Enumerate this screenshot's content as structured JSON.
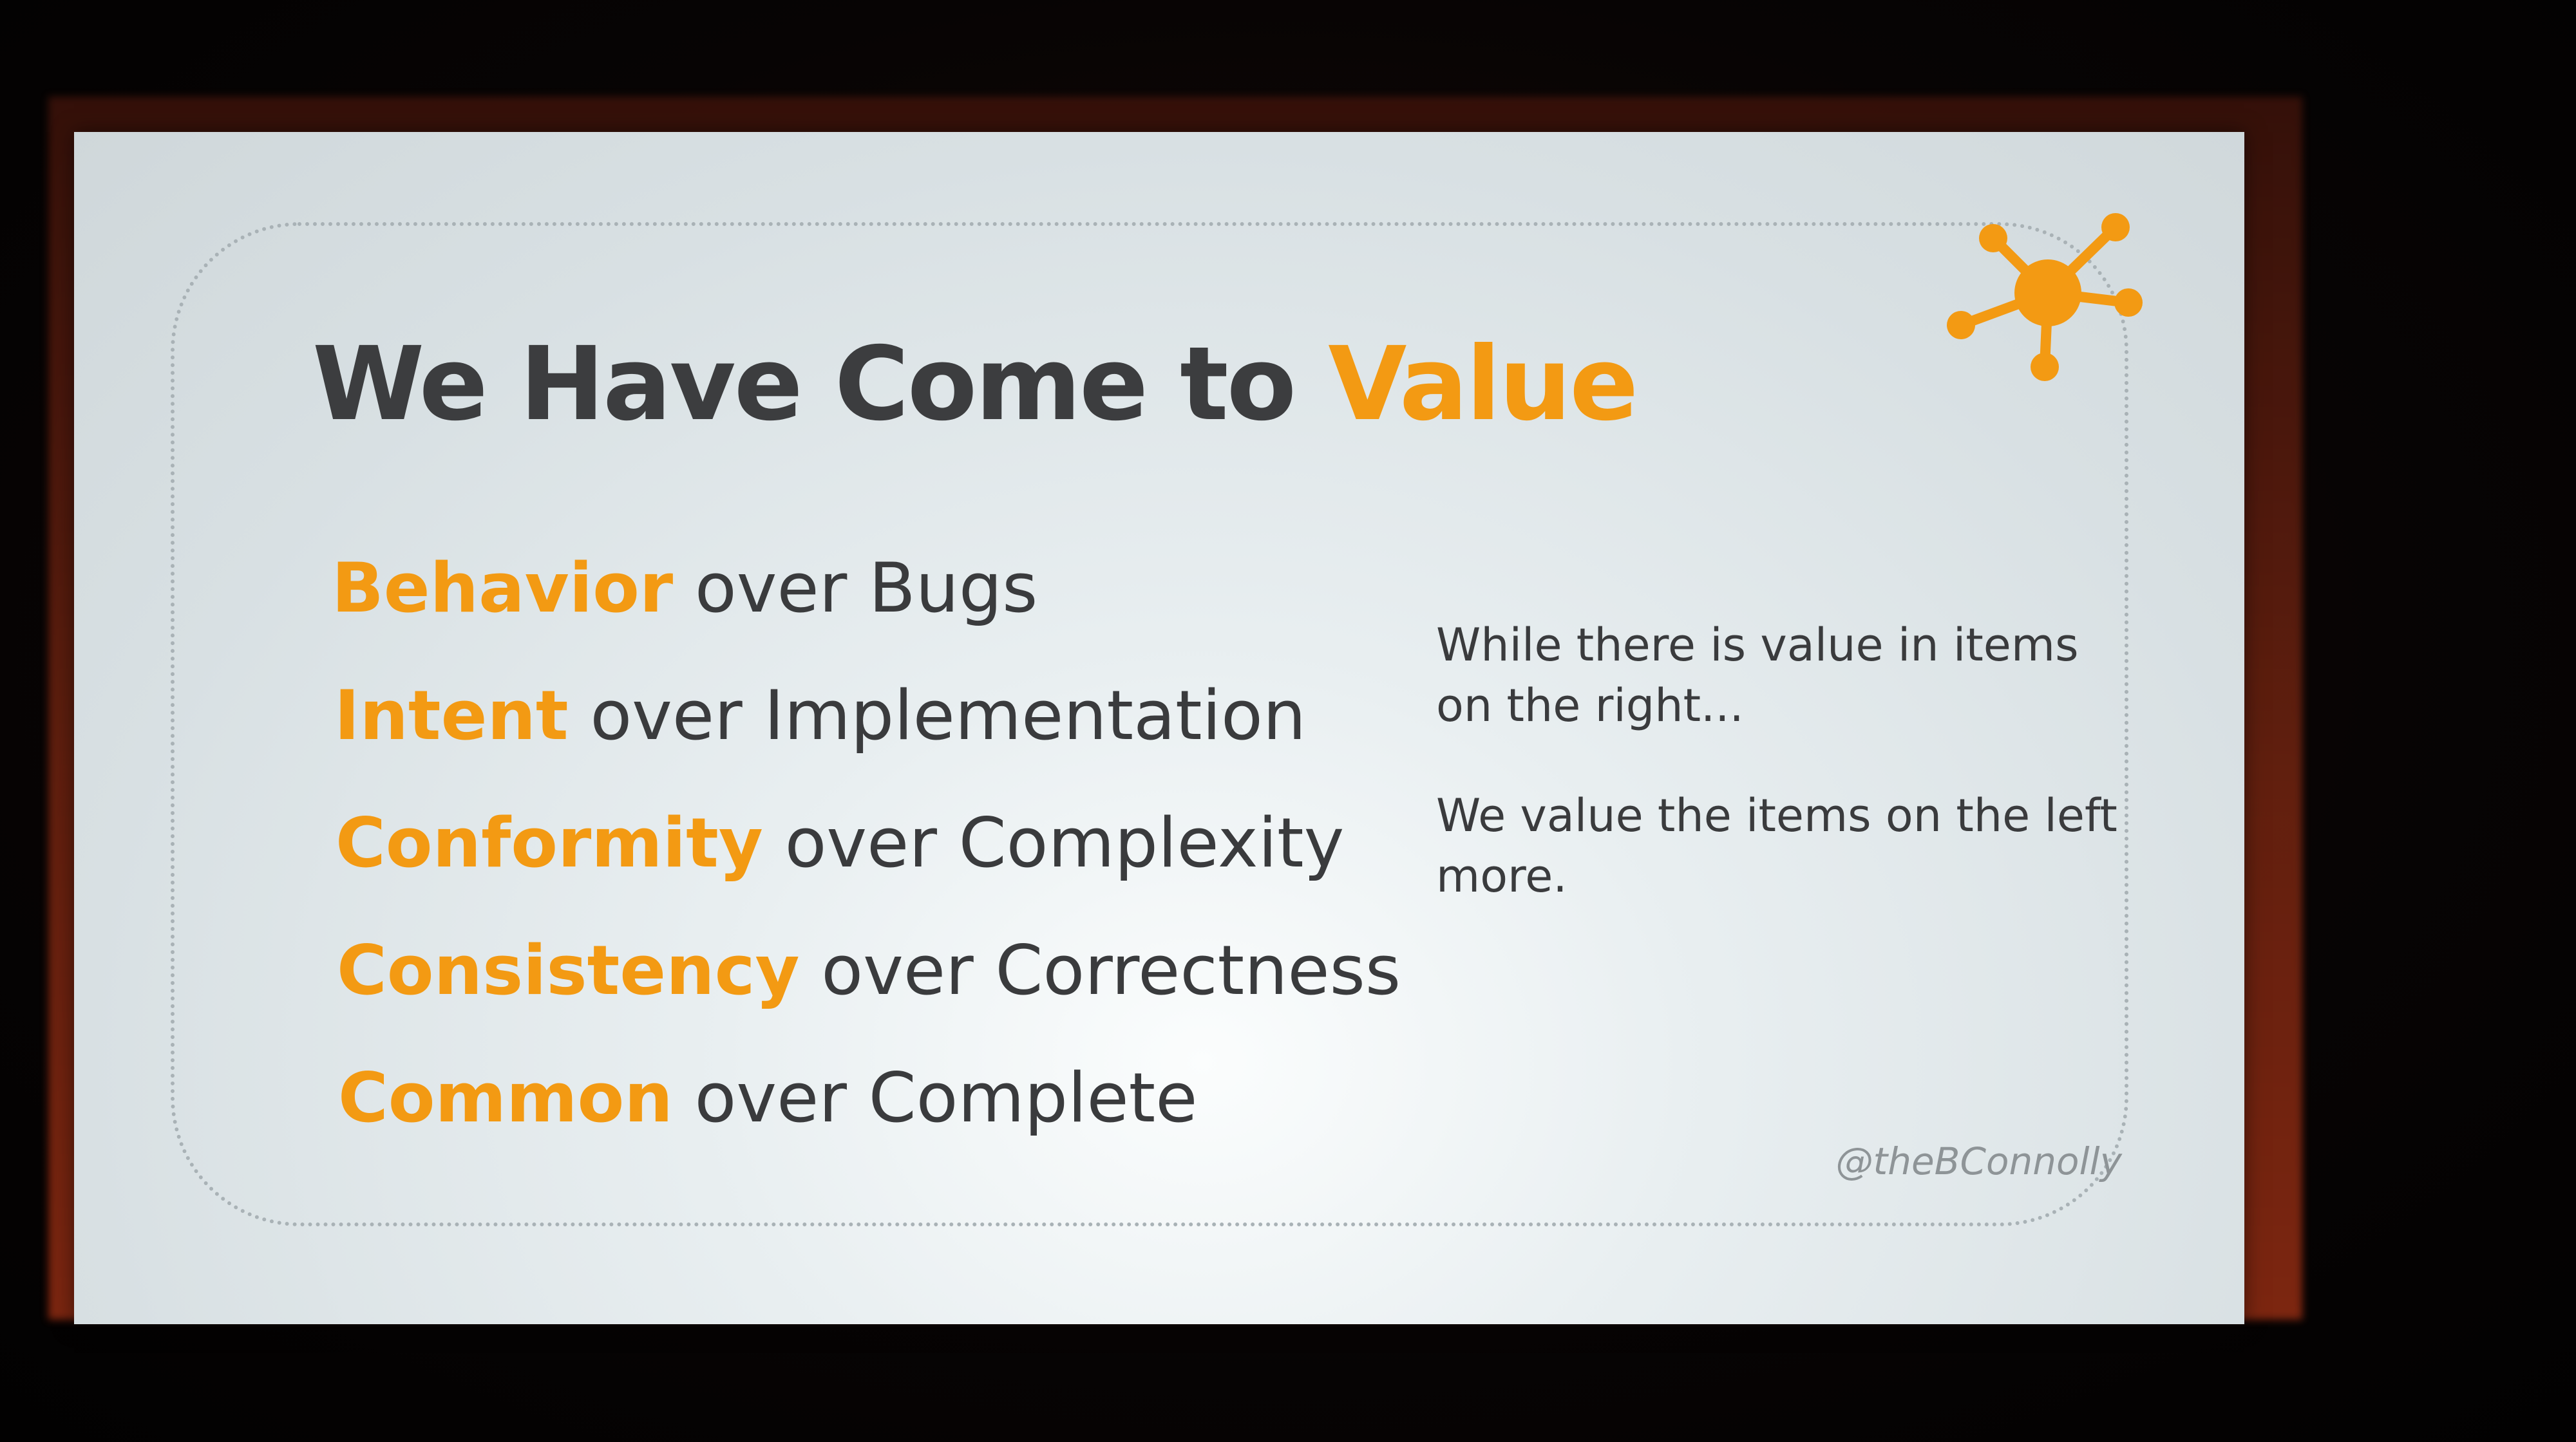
{
  "slide": {
    "title_prefix": "We Have Come to",
    "title_accent": "Value",
    "items": [
      {
        "highlight": "Behavior",
        "rest": "over Bugs"
      },
      {
        "highlight": "Intent",
        "rest": "over Implementation"
      },
      {
        "highlight": "Conformity",
        "rest": "over Complexity"
      },
      {
        "highlight": "Consistency",
        "rest": "over Correctness"
      },
      {
        "highlight": "Common",
        "rest": "over Complete"
      }
    ],
    "note_1": "While there is value in items on the right...",
    "note_2": "We value the items on the left more.",
    "handle": "@theBConnolly",
    "logo_icon": "network-hub-icon"
  },
  "colors": {
    "accent": "#f39a13",
    "text": "#3a3b3d",
    "slide_background": "#e4eaec"
  }
}
